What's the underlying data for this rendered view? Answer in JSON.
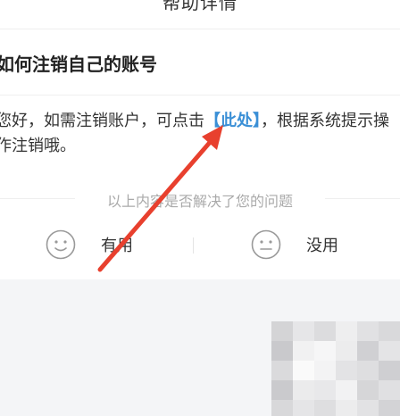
{
  "nav": {
    "title": "帮助详情"
  },
  "article": {
    "title": "如何注销自己的账号",
    "text_before_link": "您好，如需注销账户，可点击",
    "link_text": "【此处】",
    "text_after_link": "，根据系统提示操作注销哦。"
  },
  "feedback": {
    "question": "以上内容是否解决了您的问题",
    "useful_label": "有用",
    "useless_label": "没用"
  },
  "colors": {
    "link": "#3a8fd6",
    "annotation_arrow": "#e8402e"
  },
  "icons": {
    "useful": "smile-face-icon",
    "useless": "neutral-face-icon"
  }
}
